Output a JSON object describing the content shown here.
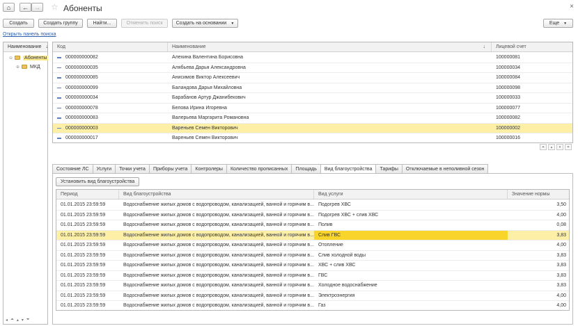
{
  "window": {
    "title": "Абоненты",
    "home_icon": "home-icon",
    "back_icon": "arrow-left-icon",
    "forward_icon": "arrow-right-icon",
    "close": "×"
  },
  "toolbar": {
    "create": "Создать",
    "create_group": "Создать группу",
    "find": "Найти...",
    "cancel_search": "Отменить поиск",
    "create_based_on": "Создать на основании",
    "more": "Еще"
  },
  "search_panel_link": "Открыть панель поиска",
  "tree": {
    "header": "Наименование",
    "sort_mark": "↓",
    "items": [
      {
        "label": "Абоненты",
        "selected": true
      },
      {
        "label": "МКД",
        "selected": false
      }
    ]
  },
  "grid": {
    "columns": [
      "Код",
      "Наименование",
      "Лицевой счет"
    ],
    "sort_mark": "↓",
    "rows": [
      {
        "code": "000000000082",
        "name": "Алехина Валентина Борисовна",
        "account": "100000081"
      },
      {
        "code": "000000000035",
        "name": "Алябьева Дарья Александровна",
        "account": "100000034"
      },
      {
        "code": "000000000085",
        "name": "Анисимов Виктор Алексеевич",
        "account": "100000084"
      },
      {
        "code": "000000000099",
        "name": "Баландова Дарья Михайловна",
        "account": "100000098"
      },
      {
        "code": "000000000034",
        "name": "Барабанов Артур Джанибекович",
        "account": "100000033"
      },
      {
        "code": "000000000078",
        "name": "Белова Ирина Игоревна",
        "account": "100000077"
      },
      {
        "code": "000000000083",
        "name": "Валерьева Маргарита Романовна",
        "account": "100000082"
      },
      {
        "code": "000000000003",
        "name": "Вареньев Семен Викторович",
        "account": "100000002",
        "selected": true
      },
      {
        "code": "000000000017",
        "name": "Вареньев Семен Викторович",
        "account": "100000016"
      }
    ]
  },
  "tabs": [
    {
      "label": "Состояние ЛС"
    },
    {
      "label": "Услуги"
    },
    {
      "label": "Точки учета"
    },
    {
      "label": "Приборы учета"
    },
    {
      "label": "Контролеры"
    },
    {
      "label": "Количество прописанных"
    },
    {
      "label": "Площадь"
    },
    {
      "label": "Вид благоустройства",
      "active": true
    },
    {
      "label": "Тарифы"
    },
    {
      "label": "Отключаемые в неполивной сезон"
    }
  ],
  "detail": {
    "set_button": "Установить вид благоустройства",
    "columns": [
      "Период",
      "Вид благоустройства",
      "Вид услуги",
      "Значение нормы"
    ],
    "rows": [
      {
        "period": "01.01.2015 23:59:59",
        "type": "Водоснабжение  жилых  домов с водопроводом,  канализацией, ванной  и горячим в...",
        "service": "Подогрев ХВС",
        "value": "3,50"
      },
      {
        "period": "01.01.2015 23:59:59",
        "type": "Водоснабжение  жилых  домов с водопроводом,  канализацией, ванной  и горячим в...",
        "service": "Подогрев ХВС + слив ХВС",
        "value": "4,00"
      },
      {
        "period": "01.01.2015 23:59:59",
        "type": "Водоснабжение  жилых  домов с водопроводом,  канализацией, ванной  и горячим в...",
        "service": "Полив",
        "value": "0,08"
      },
      {
        "period": "01.01.2015 23:59:59",
        "type": "Водоснабжение  жилых  домов с водопроводом,  канализацией, ванной  и горячим в...",
        "service": "Слив ГВС",
        "value": "3,83",
        "selected": true
      },
      {
        "period": "01.01.2015 23:59:59",
        "type": "Водоснабжение  жилых  домов с водопроводом,  канализацией, ванной  и горячим в...",
        "service": "Отопление",
        "value": "4,00"
      },
      {
        "period": "01.01.2015 23:59:59",
        "type": "Водоснабжение  жилых  домов с водопроводом,  канализацией, ванной  и горячим в...",
        "service": "Слив холодной воды",
        "value": "3,83"
      },
      {
        "period": "01.01.2015 23:59:59",
        "type": "Водоснабжение  жилых  домов с водопроводом,  канализацией, ванной  и горячим в...",
        "service": "ХВС + слив ХВС",
        "value": "3,83"
      },
      {
        "period": "01.01.2015 23:59:59",
        "type": "Водоснабжение  жилых  домов с водопроводом,  канализацией, ванной  и горячим в...",
        "service": "ГВС",
        "value": "3,83"
      },
      {
        "period": "01.01.2015 23:59:59",
        "type": "Водоснабжение  жилых  домов с водопроводом,  канализацией, ванной  и горячим в...",
        "service": "Холодное водоснабжение",
        "value": "3,83"
      },
      {
        "period": "01.01.2015 23:59:59",
        "type": "Водоснабжение  жилых  домов с водопроводом,  канализацией, ванной  и горячим в...",
        "service": "Электроэнергия",
        "value": "4,00"
      },
      {
        "period": "01.01.2015 23:59:59",
        "type": "Водоснабжение  жилых  домов с водопроводом,  канализацией, ванной  и горячим в...",
        "service": "Газ",
        "value": "4,00"
      }
    ]
  }
}
